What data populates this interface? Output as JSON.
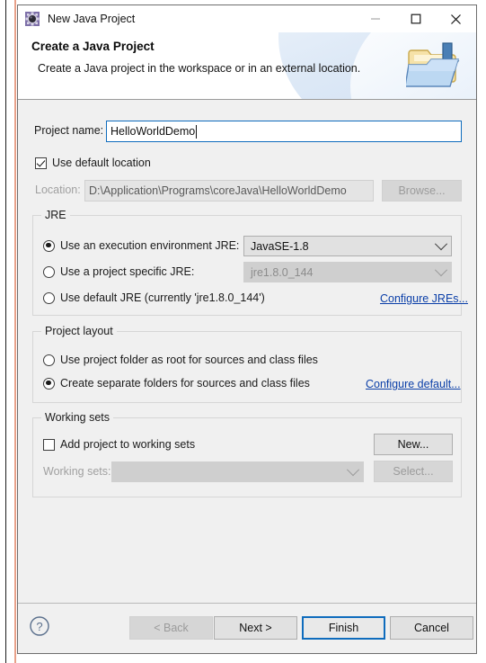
{
  "window": {
    "title": "New Java Project",
    "icon": "eclipse-java-project-icon",
    "controls": {
      "minimize": "minimize-icon",
      "maximize": "maximize-icon",
      "close": "close-icon"
    }
  },
  "header": {
    "title": "Create a Java Project",
    "subtitle": "Create a Java project in the workspace or in an external location.",
    "banner_icon": "new-java-project-folder-icon"
  },
  "project_name": {
    "label": "Project name:",
    "value": "HelloWorldDemo",
    "placeholder": ""
  },
  "location": {
    "use_default_label": "Use default location",
    "use_default_checked": true,
    "label": "Location:",
    "value": "D:\\Application\\Programs\\coreJava\\HelloWorldDemo",
    "browse_label": "Browse..."
  },
  "jre": {
    "group_title": "JRE",
    "options": [
      {
        "label": "Use an execution environment JRE:",
        "selected": true,
        "combo_value": "JavaSE-1.8",
        "combo_enabled": true
      },
      {
        "label": "Use a project specific JRE:",
        "selected": false,
        "combo_value": "jre1.8.0_144",
        "combo_enabled": false
      },
      {
        "label": "Use default JRE (currently 'jre1.8.0_144')",
        "selected": false
      }
    ],
    "configure_link": "Configure JREs..."
  },
  "project_layout": {
    "group_title": "Project layout",
    "options": [
      {
        "label": "Use project folder as root for sources and class files",
        "selected": false
      },
      {
        "label": "Create separate folders for sources and class files",
        "selected": true
      }
    ],
    "configure_link": "Configure default..."
  },
  "working_sets": {
    "group_title": "Working sets",
    "add_label": "Add project to working sets",
    "add_checked": false,
    "new_label": "New...",
    "sets_label": "Working sets:",
    "sets_value": "",
    "select_label": "Select..."
  },
  "footer": {
    "help_icon": "help-question-icon",
    "back_label": "< Back",
    "back_enabled": false,
    "next_label": "Next >",
    "finish_label": "Finish",
    "cancel_label": "Cancel"
  },
  "colors": {
    "accent_focus": "#0f6cbd",
    "link": "#0b3fa8",
    "dialog_bg": "#f0f0f0",
    "header_bg": "#ffffff",
    "backdrop_line": "#e8a089"
  }
}
